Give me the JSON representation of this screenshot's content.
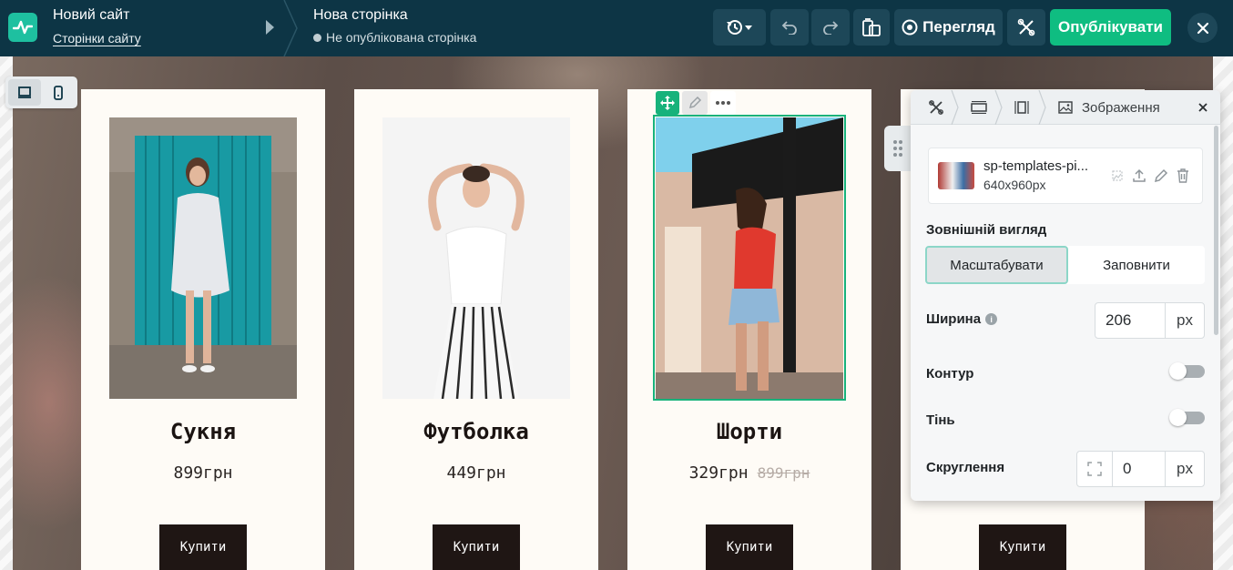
{
  "topbar": {
    "site_title": "Новий сайт",
    "site_pages_link": "Сторінки сайту",
    "page_title": "Нова сторінка",
    "page_status": "Не опублікована сторінка",
    "preview_label": "Перегляд",
    "publish_label": "Опублікувати",
    "icons": [
      "history-icon",
      "undo-icon",
      "redo-icon",
      "responsive-icon",
      "eye-icon",
      "tools-icon",
      "close-icon"
    ]
  },
  "products": [
    {
      "name": "Сукня",
      "price": "899грн",
      "old_price": "",
      "buy_label": "Купити"
    },
    {
      "name": "Футболка",
      "price": "449грн",
      "old_price": "",
      "buy_label": "Купити"
    },
    {
      "name": "Шорти",
      "price": "329грн",
      "old_price": "899грн",
      "buy_label": "Купити"
    },
    {
      "name": "",
      "price": "",
      "old_price": "",
      "buy_label": "Купити"
    }
  ],
  "panel": {
    "tab_image_label": "Зображення",
    "file_name": "sp-templates-pi...",
    "file_size": "640x960px",
    "appearance_label": "Зовнішній вигляд",
    "appearance_options": [
      "Масштабувати",
      "Заповнити"
    ],
    "appearance_selected": "Масштабувати",
    "width_label": "Ширина",
    "width_value": "206",
    "width_unit": "px",
    "outline_label": "Контур",
    "outline_on": false,
    "shadow_label": "Тінь",
    "shadow_on": false,
    "radius_label": "Скруглення",
    "radius_value": "0",
    "radius_unit": "px"
  },
  "colors": {
    "topbar_bg": "#0d3545",
    "publish_green": "#0fbd81",
    "selection_green": "#17b27b",
    "card_bg": "#fefbf6",
    "buy_button_bg": "#1f1614"
  }
}
